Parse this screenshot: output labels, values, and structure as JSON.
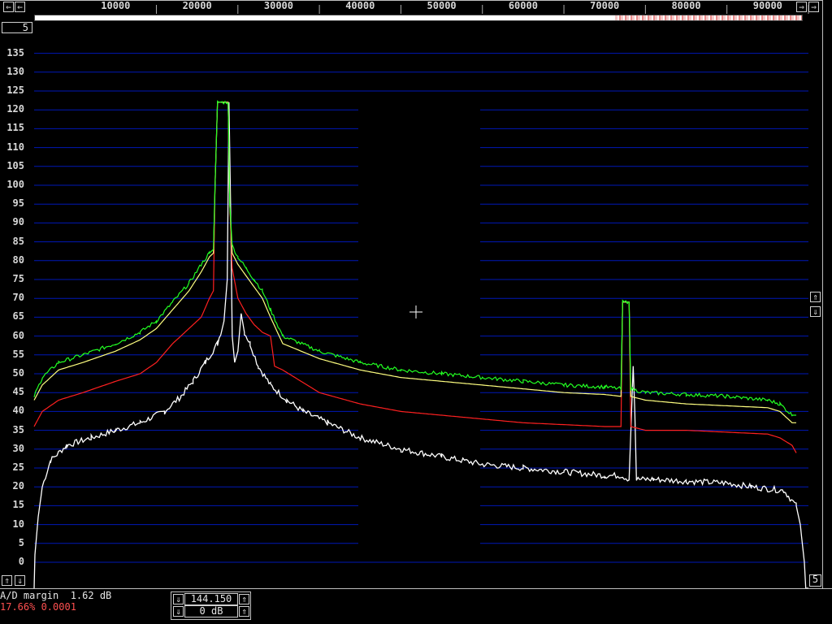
{
  "chart_data": {
    "type": "line",
    "xlim": [
      0,
      95000
    ],
    "x_ticks": [
      10000,
      20000,
      30000,
      40000,
      50000,
      60000,
      70000,
      80000,
      90000
    ],
    "ylim": [
      -5,
      137
    ],
    "y_ticks": [
      0,
      5,
      10,
      15,
      20,
      25,
      30,
      35,
      40,
      45,
      50,
      55,
      60,
      65,
      70,
      75,
      80,
      85,
      90,
      95,
      100,
      105,
      110,
      115,
      120,
      125,
      130,
      135
    ],
    "grid": true,
    "series": [
      {
        "color": "#ffffff",
        "points": [
          [
            0,
            -100
          ],
          [
            100,
            2
          ],
          [
            500,
            12
          ],
          [
            1000,
            20
          ],
          [
            2000,
            27
          ],
          [
            4000,
            31
          ],
          [
            7000,
            33
          ],
          [
            10000,
            35
          ],
          [
            13000,
            37
          ],
          [
            16000,
            40
          ],
          [
            18000,
            44
          ],
          [
            19500,
            48
          ],
          [
            21000,
            53
          ],
          [
            22500,
            58
          ],
          [
            23300,
            64
          ],
          [
            23700,
            75
          ],
          [
            23900,
            122
          ],
          [
            24100,
            95
          ],
          [
            24300,
            60
          ],
          [
            24600,
            53
          ],
          [
            25000,
            56
          ],
          [
            25400,
            66
          ],
          [
            25800,
            61
          ],
          [
            26500,
            58
          ],
          [
            27500,
            52
          ],
          [
            29000,
            47
          ],
          [
            31000,
            43
          ],
          [
            33000,
            40
          ],
          [
            36000,
            37
          ],
          [
            40000,
            33
          ],
          [
            45000,
            30
          ],
          [
            50000,
            28
          ],
          [
            55000,
            26
          ],
          [
            60000,
            25
          ],
          [
            65000,
            24
          ],
          [
            70000,
            23
          ],
          [
            72000,
            23
          ],
          [
            73000,
            22
          ],
          [
            73300,
            40
          ],
          [
            73500,
            52
          ],
          [
            73700,
            40
          ],
          [
            73900,
            22
          ],
          [
            76000,
            22
          ],
          [
            80000,
            21.5
          ],
          [
            85000,
            21
          ],
          [
            88000,
            20
          ],
          [
            92000,
            19
          ],
          [
            93500,
            15
          ],
          [
            94000,
            10
          ],
          [
            94500,
            0
          ],
          [
            95000,
            -100
          ]
        ]
      },
      {
        "color": "#ff2020",
        "points": [
          [
            0,
            36
          ],
          [
            1000,
            40
          ],
          [
            3000,
            43
          ],
          [
            6000,
            45
          ],
          [
            10000,
            48
          ],
          [
            13000,
            50
          ],
          [
            15000,
            53
          ],
          [
            17000,
            58
          ],
          [
            19000,
            62
          ],
          [
            20500,
            65
          ],
          [
            21500,
            70
          ],
          [
            22000,
            72
          ],
          [
            22200,
            100
          ],
          [
            22500,
            122
          ],
          [
            23800,
            122
          ],
          [
            24000,
            95
          ],
          [
            24300,
            78
          ],
          [
            25000,
            70
          ],
          [
            26000,
            66
          ],
          [
            27000,
            63
          ],
          [
            28000,
            61
          ],
          [
            29000,
            60
          ],
          [
            29500,
            52
          ],
          [
            30500,
            51
          ],
          [
            35000,
            45
          ],
          [
            40000,
            42
          ],
          [
            45000,
            40
          ],
          [
            50000,
            39
          ],
          [
            55000,
            38
          ],
          [
            60000,
            37
          ],
          [
            65000,
            36.5
          ],
          [
            70000,
            36
          ],
          [
            72000,
            36
          ],
          [
            72200,
            69
          ],
          [
            72800,
            69
          ],
          [
            73000,
            69
          ],
          [
            73200,
            36
          ],
          [
            75000,
            35
          ],
          [
            80000,
            35
          ],
          [
            85000,
            34.5
          ],
          [
            90000,
            34
          ],
          [
            91500,
            33
          ],
          [
            93000,
            31
          ],
          [
            93500,
            29
          ]
        ]
      },
      {
        "color": "#ffff80",
        "points": [
          [
            0,
            43
          ],
          [
            1000,
            47
          ],
          [
            3000,
            51
          ],
          [
            6000,
            53
          ],
          [
            10000,
            56
          ],
          [
            13000,
            59
          ],
          [
            15000,
            62
          ],
          [
            17000,
            67
          ],
          [
            19000,
            72
          ],
          [
            20500,
            77
          ],
          [
            21500,
            81
          ],
          [
            22000,
            82
          ],
          [
            22200,
            100
          ],
          [
            22500,
            122
          ],
          [
            23800,
            122
          ],
          [
            24000,
            95
          ],
          [
            24300,
            82
          ],
          [
            25000,
            79
          ],
          [
            26000,
            76
          ],
          [
            27000,
            73
          ],
          [
            28000,
            70
          ],
          [
            29000,
            65
          ],
          [
            30500,
            58
          ],
          [
            35000,
            54
          ],
          [
            40000,
            51
          ],
          [
            45000,
            49
          ],
          [
            50000,
            48
          ],
          [
            55000,
            47
          ],
          [
            60000,
            46
          ],
          [
            65000,
            45
          ],
          [
            70000,
            44.5
          ],
          [
            72000,
            44
          ],
          [
            72200,
            69
          ],
          [
            72800,
            69
          ],
          [
            73000,
            69
          ],
          [
            73200,
            44
          ],
          [
            75000,
            43
          ],
          [
            80000,
            42
          ],
          [
            85000,
            41.5
          ],
          [
            90000,
            41
          ],
          [
            91500,
            40
          ],
          [
            93000,
            37
          ],
          [
            93500,
            37
          ]
        ]
      },
      {
        "color": "#22ff22",
        "points": [
          [
            0,
            44
          ],
          [
            1000,
            49
          ],
          [
            3000,
            53
          ],
          [
            6000,
            55
          ],
          [
            10000,
            58
          ],
          [
            13000,
            61
          ],
          [
            15000,
            64
          ],
          [
            17000,
            69
          ],
          [
            19000,
            74
          ],
          [
            20500,
            79
          ],
          [
            21500,
            82
          ],
          [
            22000,
            83
          ],
          [
            22200,
            100
          ],
          [
            22500,
            122
          ],
          [
            23800,
            122
          ],
          [
            24000,
            95
          ],
          [
            24300,
            84
          ],
          [
            25000,
            81
          ],
          [
            26000,
            78
          ],
          [
            27000,
            75
          ],
          [
            28000,
            72
          ],
          [
            29000,
            67
          ],
          [
            30500,
            60
          ],
          [
            35000,
            56
          ],
          [
            40000,
            53
          ],
          [
            45000,
            51
          ],
          [
            50000,
            50
          ],
          [
            55000,
            49
          ],
          [
            60000,
            48
          ],
          [
            65000,
            47
          ],
          [
            70000,
            46.5
          ],
          [
            72000,
            46
          ],
          [
            72200,
            69
          ],
          [
            72800,
            69
          ],
          [
            73000,
            69
          ],
          [
            73200,
            46
          ],
          [
            75000,
            45
          ],
          [
            80000,
            44.5
          ],
          [
            85000,
            44
          ],
          [
            90000,
            43
          ],
          [
            91500,
            42
          ],
          [
            93000,
            39
          ],
          [
            93500,
            39
          ]
        ]
      }
    ]
  },
  "status": {
    "ad_margin": "A/D margin  1.62 dB",
    "cpu_load": "17.66% 0.0001",
    "frequency": "144.150",
    "gain": "0 dB",
    "corner_number": "5",
    "top_left_tag": "5"
  },
  "buttons": {
    "arrow_left": "⇐",
    "arrow_right": "⇒",
    "arrow_up": "⇑",
    "arrow_down": "⇓"
  },
  "colors": {
    "grid": "#0018b8",
    "background": "#000000",
    "frame": "#bfbfbf",
    "cpu_text": "#ff5050"
  }
}
